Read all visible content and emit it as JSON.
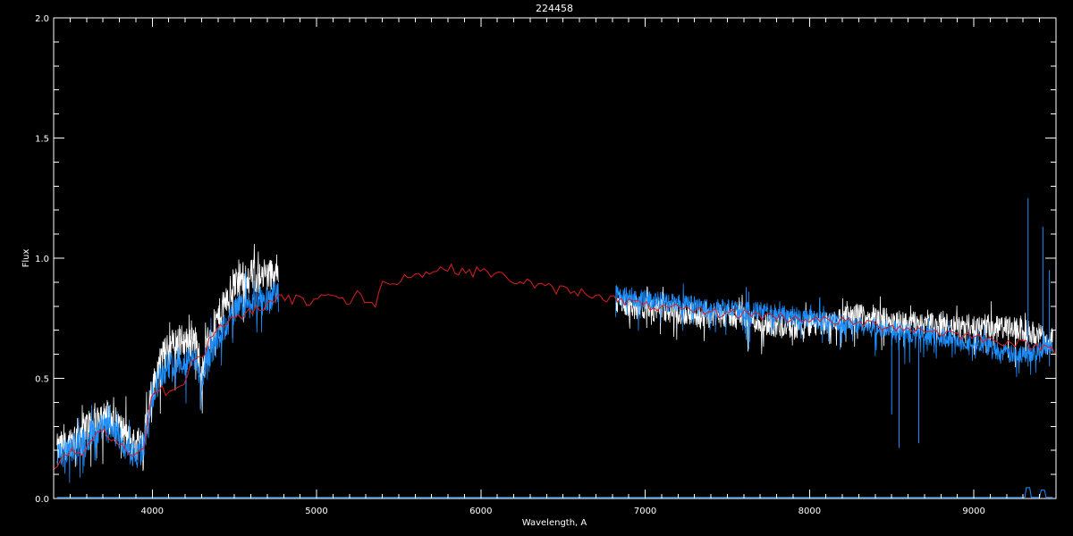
{
  "chart_data": {
    "type": "line",
    "title": "224458",
    "xlabel": "Wavelength, A",
    "ylabel": "Flux",
    "xlim": [
      3400,
      9500
    ],
    "ylim": [
      0.0,
      2.0
    ],
    "x_ticks": [
      4000,
      5000,
      6000,
      7000,
      8000,
      9000
    ],
    "x_tick_labels": [
      "4000",
      "5000",
      "6000",
      "7000",
      "8000",
      "9000"
    ],
    "x_minor_step": 100,
    "y_ticks": [
      0.0,
      0.5,
      1.0,
      1.5,
      2.0
    ],
    "y_tick_labels": [
      "0.0",
      "0.5",
      "1.0",
      "1.5",
      "2.0"
    ],
    "y_minor_step": 0.1,
    "grid": false,
    "legend": "none",
    "background": "#000000",
    "series": [
      {
        "color": "#ffffff",
        "style": "noisy spectrum",
        "segments": [
          {
            "x": [
              3420,
              3500,
              3600,
              3650,
              3700,
              3750,
              3800,
              3850,
              3900,
              3950,
              4000,
              4050,
              4100,
              4150,
              4200,
              4250,
              4300,
              4350,
              4400,
              4450,
              4500,
              4550,
              4600,
              4650,
              4700,
              4770
            ],
            "y": [
              0.2,
              0.24,
              0.3,
              0.33,
              0.36,
              0.33,
              0.3,
              0.25,
              0.22,
              0.28,
              0.45,
              0.58,
              0.62,
              0.66,
              0.65,
              0.68,
              0.55,
              0.68,
              0.75,
              0.82,
              0.9,
              0.92,
              0.93,
              0.92,
              0.93,
              0.95
            ],
            "noise": 0.07
          },
          {
            "x": [
              6820,
              6900,
              7000,
              7100,
              7200,
              7300,
              7400,
              7500,
              7600,
              7700,
              7800,
              7900,
              8000,
              8100,
              8200,
              8300,
              8400,
              8500,
              8600,
              8700,
              8800,
              8900,
              9000,
              9100,
              9200,
              9300,
              9400,
              9480
            ],
            "y": [
              0.82,
              0.8,
              0.79,
              0.78,
              0.77,
              0.77,
              0.76,
              0.76,
              0.76,
              0.73,
              0.72,
              0.71,
              0.72,
              0.73,
              0.75,
              0.76,
              0.75,
              0.74,
              0.73,
              0.73,
              0.72,
              0.71,
              0.72,
              0.72,
              0.71,
              0.7,
              0.68,
              0.66
            ],
            "noise": 0.05
          }
        ]
      },
      {
        "color": "#1e90ff",
        "style": "noisy spectrum",
        "segments": [
          {
            "x": [
              3420,
              3500,
              3600,
              3650,
              3700,
              3750,
              3800,
              3850,
              3900,
              3950,
              4000,
              4050,
              4100,
              4150,
              4200,
              4250,
              4300,
              4350,
              4400,
              4450,
              4500,
              4550,
              4600,
              4650,
              4700,
              4770
            ],
            "y": [
              0.17,
              0.2,
              0.25,
              0.28,
              0.3,
              0.28,
              0.25,
              0.2,
              0.18,
              0.22,
              0.42,
              0.52,
              0.55,
              0.58,
              0.57,
              0.6,
              0.48,
              0.6,
              0.66,
              0.72,
              0.78,
              0.8,
              0.81,
              0.82,
              0.83,
              0.86
            ],
            "noise": 0.06
          },
          {
            "x": [
              6820,
              6900,
              7000,
              7100,
              7200,
              7300,
              7400,
              7500,
              7600,
              7700,
              7800,
              7900,
              8000,
              8100,
              8200,
              8300,
              8400,
              8500,
              8600,
              8700,
              8800,
              8900,
              9000,
              9100,
              9200,
              9300,
              9400,
              9480
            ],
            "y": [
              0.85,
              0.84,
              0.83,
              0.82,
              0.81,
              0.8,
              0.79,
              0.79,
              0.78,
              0.78,
              0.77,
              0.76,
              0.75,
              0.74,
              0.73,
              0.72,
              0.71,
              0.7,
              0.69,
              0.68,
              0.67,
              0.66,
              0.65,
              0.63,
              0.6,
              0.6,
              0.62,
              0.64
            ],
            "noise": 0.04
          }
        ],
        "spikes": [
          {
            "x": 7615,
            "y_top": 0.88,
            "y_bottom": 0.66
          },
          {
            "x": 7630,
            "y_top": 0.86,
            "y_bottom": 0.62
          },
          {
            "x": 8500,
            "y_top": 0.7,
            "y_bottom": 0.35
          },
          {
            "x": 8545,
            "y_top": 0.7,
            "y_bottom": 0.21
          },
          {
            "x": 8665,
            "y_top": 0.7,
            "y_bottom": 0.23
          },
          {
            "x": 9330,
            "y_top": 1.25,
            "y_bottom": 0.55
          },
          {
            "x": 9420,
            "y_top": 1.13,
            "y_bottom": 0.6
          },
          {
            "x": 9460,
            "y_top": 0.95,
            "y_bottom": 0.55
          }
        ],
        "error_x": [
          3420,
          9480
        ],
        "error_y": 0.005,
        "error_bumps": [
          {
            "x": 9330,
            "y": 0.045
          },
          {
            "x": 9420,
            "y": 0.035
          }
        ]
      },
      {
        "color": "#dc1e1e",
        "style": "model",
        "segments": [
          {
            "x": [
              3400,
              3450,
              3500,
              3550,
              3600,
              3650,
              3700,
              3750,
              3800,
              3850,
              3900,
              3950,
              4000,
              4050,
              4100,
              4150,
              4200,
              4250,
              4300,
              4350,
              4400,
              4450,
              4500,
              4550,
              4600,
              4650,
              4700,
              4750,
              4800,
              4850,
              4900,
              4950,
              5000,
              5050,
              5100,
              5150,
              5200,
              5250,
              5300,
              5350,
              5400,
              5450,
              5500,
              5550,
              5600,
              5650,
              5700,
              5750,
              5800,
              5850,
              5900,
              5950,
              6000,
              6050,
              6100,
              6150,
              6200,
              6250,
              6300,
              6350,
              6400,
              6450,
              6500,
              6550,
              6600,
              6650,
              6700,
              6750,
              6800,
              6850,
              6900,
              6950,
              7000,
              7050,
              7100,
              7150,
              7200,
              7250,
              7300,
              7350,
              7400,
              7450,
              7500,
              7550,
              7600,
              7650,
              7700,
              7750,
              7800,
              7850,
              7900,
              7950,
              8000,
              8050,
              8100,
              8150,
              8200,
              8250,
              8300,
              8350,
              8400,
              8450,
              8500,
              8550,
              8600,
              8650,
              8700,
              8750,
              8800,
              8850,
              8900,
              8950,
              9000,
              9050,
              9100,
              9150,
              9200,
              9250,
              9300,
              9350,
              9400,
              9450,
              9500
            ],
            "y": [
              0.12,
              0.16,
              0.2,
              0.18,
              0.2,
              0.26,
              0.28,
              0.25,
              0.22,
              0.2,
              0.18,
              0.22,
              0.44,
              0.46,
              0.44,
              0.46,
              0.5,
              0.6,
              0.58,
              0.66,
              0.7,
              0.72,
              0.76,
              0.74,
              0.78,
              0.8,
              0.8,
              0.84,
              0.84,
              0.82,
              0.86,
              0.8,
              0.84,
              0.84,
              0.86,
              0.83,
              0.81,
              0.85,
              0.83,
              0.8,
              0.89,
              0.91,
              0.9,
              0.94,
              0.93,
              0.93,
              0.95,
              0.95,
              0.96,
              0.95,
              0.95,
              0.94,
              0.95,
              0.94,
              0.93,
              0.92,
              0.91,
              0.9,
              0.9,
              0.88,
              0.88,
              0.87,
              0.87,
              0.86,
              0.86,
              0.85,
              0.85,
              0.84,
              0.83,
              0.82,
              0.82,
              0.81,
              0.8,
              0.8,
              0.79,
              0.79,
              0.79,
              0.78,
              0.78,
              0.78,
              0.78,
              0.77,
              0.77,
              0.77,
              0.77,
              0.77,
              0.76,
              0.76,
              0.76,
              0.75,
              0.75,
              0.75,
              0.75,
              0.74,
              0.74,
              0.74,
              0.74,
              0.73,
              0.73,
              0.73,
              0.72,
              0.72,
              0.72,
              0.71,
              0.71,
              0.7,
              0.7,
              0.7,
              0.69,
              0.69,
              0.68,
              0.68,
              0.67,
              0.67,
              0.66,
              0.66,
              0.65,
              0.65,
              0.64,
              0.64,
              0.63,
              0.63,
              0.62
            ],
            "noise": 0.02
          }
        ]
      }
    ]
  }
}
